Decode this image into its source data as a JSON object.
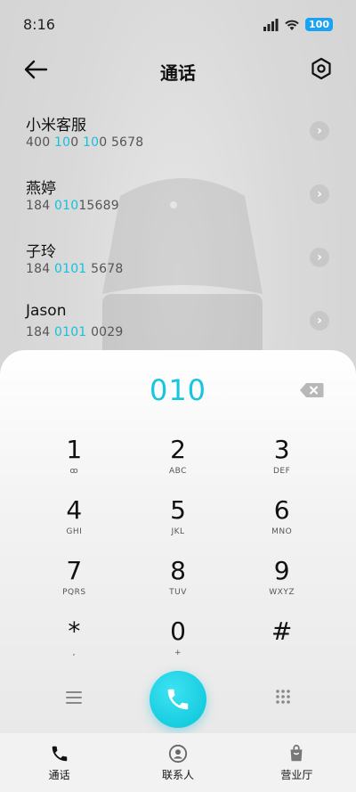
{
  "status_bar": {
    "time": "8:16",
    "battery": "100"
  },
  "header": {
    "title": "通话"
  },
  "contacts": [
    {
      "name": "小米客服",
      "num_pre": "400 ",
      "num_hl": "10",
      "num_mid": "0 ",
      "num_hl2": "10",
      "num_post": "0 5678"
    },
    {
      "name": "燕婷",
      "num_pre": "184 ",
      "num_hl": "010",
      "num_mid": "",
      "num_hl2": "",
      "num_post": "15689"
    },
    {
      "name": "子玲",
      "num_pre": "184 ",
      "num_hl": "0101",
      "num_mid": "",
      "num_hl2": "",
      "num_post": " 5678"
    },
    {
      "name": "Jason",
      "num_pre": "184 ",
      "num_hl": "0101",
      "num_mid": "",
      "num_hl2": "",
      "num_post": " 0029"
    }
  ],
  "dialer": {
    "entered": "010",
    "keys": [
      {
        "digit": "1",
        "letters": "ꝏ"
      },
      {
        "digit": "2",
        "letters": "ABC"
      },
      {
        "digit": "3",
        "letters": "DEF"
      },
      {
        "digit": "4",
        "letters": "GHI"
      },
      {
        "digit": "5",
        "letters": "JKL"
      },
      {
        "digit": "6",
        "letters": "MNO"
      },
      {
        "digit": "7",
        "letters": "PQRS"
      },
      {
        "digit": "8",
        "letters": "TUV"
      },
      {
        "digit": "9",
        "letters": "WXYZ"
      },
      {
        "digit": "*",
        "letters": ","
      },
      {
        "digit": "0",
        "letters": "+"
      },
      {
        "digit": "#",
        "letters": ""
      }
    ]
  },
  "tabs": [
    {
      "label": "通话"
    },
    {
      "label": "联系人"
    },
    {
      "label": "营业厅"
    }
  ],
  "colors": {
    "accent": "#16c6df"
  }
}
